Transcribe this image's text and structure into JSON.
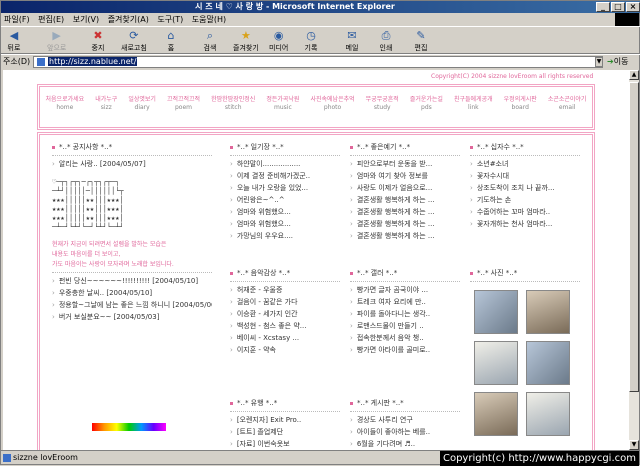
{
  "window": {
    "title": "시 즈 네 ♡ 사 랑 방 - Microsoft Internet Explorer"
  },
  "menu": [
    "파일(F)",
    "편집(E)",
    "보기(V)",
    "즐겨찾기(A)",
    "도구(T)",
    "도움말(H)"
  ],
  "toolbar": [
    {
      "label": "뒤로",
      "icon": "back-arrow-icon"
    },
    {
      "label": "앞으로",
      "icon": "forward-arrow-icon"
    },
    {
      "label": "중지",
      "icon": "stop-icon"
    },
    {
      "label": "새로고침",
      "icon": "refresh-icon"
    },
    {
      "label": "홈",
      "icon": "home-icon"
    },
    {
      "label": "검색",
      "icon": "search-icon"
    },
    {
      "label": "즐겨찾기",
      "icon": "favorites-icon"
    },
    {
      "label": "미디어",
      "icon": "media-icon"
    },
    {
      "label": "기록",
      "icon": "history-icon"
    },
    {
      "label": "메일",
      "icon": "mail-icon"
    },
    {
      "label": "인쇄",
      "icon": "print-icon"
    },
    {
      "label": "편집",
      "icon": "edit-icon"
    }
  ],
  "address": {
    "label": "주소(D)",
    "url": "http://sizz.nablue.net/",
    "go": "이동"
  },
  "status": {
    "text": "sizzne lovEroom",
    "copyright": "Copyright(c) http://www.happycgi.com"
  },
  "site": {
    "copyright_top": "Copyright(C) 2004 sizzne lovEroom all rights reserved",
    "nav": [
      {
        "kr": "처음으로가세요",
        "en": "home"
      },
      {
        "kr": "내가누구",
        "en": "sizz"
      },
      {
        "kr": "일상엿보기",
        "en": "diary"
      },
      {
        "kr": "끄적끄적끄적",
        "en": "poem"
      },
      {
        "kr": "한땀한땀장인정신",
        "en": "stitch"
      },
      {
        "kr": "정든가곡낙원",
        "en": "music"
      },
      {
        "kr": "사진속에남은추억",
        "en": "photo"
      },
      {
        "kr": "무궁무궁흔적",
        "en": "study"
      },
      {
        "kr": "즐거운가는길",
        "en": "pds"
      },
      {
        "kr": "친구들에게공개",
        "en": "link"
      },
      {
        "kr": "우정의게시판",
        "en": "board"
      },
      {
        "kr": "소곤소곤이야기",
        "en": "email"
      }
    ],
    "notice": {
      "title": "*..* 공지사항 *..*",
      "items": [
        "알리는 사랑..  [2004/05/07]"
      ],
      "msg": [
        "현재가 지금이 되려면서 설렘을 발하는 모습은",
        "내용도 마음이를 더 보이고,",
        "가도 마음이는 사랑이 모자라며 노래합 보입니다."
      ],
      "extra": [
        "펀빈 당신~~~~~~!!!!!!!!!!  [2004/05/10]",
        "우중충한 날씨..  [2004/05/10]",
        "정용할~그날에 남는 좋은 느낌 하니니  [2004/05/06]",
        "버거 보실분요~~  [2004/05/03]"
      ]
    },
    "cols": [
      {
        "title": "*..* 일기장 *..*",
        "items": [
          "하얀말이.................",
          "이제 결정 준비해가겠군..",
          "오늘 내가 오랑을 있었...",
          "어린왕은~^..^",
          "엄마와 위험했으...",
          "엄마와 위험했으...",
          "가망님의 우우요...."
        ]
      },
      {
        "title": "*..* 좋은예기 *..*",
        "items": [
          "피안으로부터 운동을 받...",
          "엄마와 여기 찾아 정보를",
          "사랑도 이제가 얼음으로...",
          "결혼생활 행복하게 하는 ...",
          "결혼생활 행복하게 하는 ...",
          "결혼생활 행복하게 하는 ...",
          "결혼생활 행복하게 하는 ..."
        ]
      },
      {
        "title": "*..* 십자수 *..*",
        "items": [
          "소년#소녀",
          "꽃자수시대",
          "상조도착이 조치 나 끝까...",
          "기도하는 손",
          "수줍어하는 꼬마 엄마라..",
          "꽃자개하는 천사 엄마라..."
        ]
      },
      {
        "title": "*..* 음악감상 *..*",
        "items": [
          "허재준 - 우울증",
          "걸음이 - 꿈같은 가다",
          "이승환 - 세가지 인간",
          "백성현 - 첨스 좋은 약...",
          "베이씨 - Xcstasy ...",
          "이지훈 - 약속"
        ]
      },
      {
        "title": "*..* 갤러 *..*",
        "items": [
          "빵가면 글자 곰국이야 ...",
          "트레크 여자 요리에 만..",
          "파이를 돌아다니는 생각..",
          "로맨스드물이 만들기 ..",
          "접속한분께서 음악 챙..",
          "빵가면 아타이를 골미로.."
        ]
      },
      {
        "title": "*..* 사진 *..*",
        "items": []
      },
      {
        "title": "*..* 유행 *..*",
        "items": [
          "[오렌지자] Exit Pro..",
          "[트트] 졸업제단",
          "[자료] 이번숙옷보"
        ]
      },
      {
        "title": "*..* 게시판 *..*",
        "items": [
          "경상도 사투리 연구",
          "아이들이 좋아하는 베를..",
          "6월을 기다려며 ♬.."
        ]
      }
    ]
  }
}
